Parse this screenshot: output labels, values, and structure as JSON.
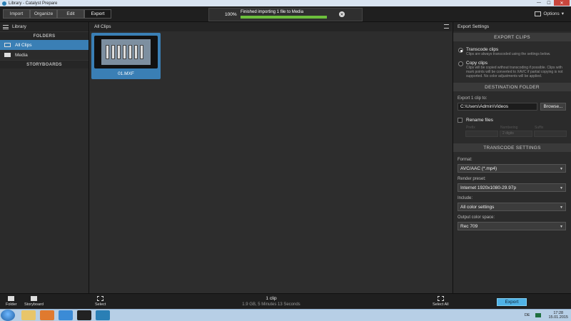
{
  "window": {
    "title": "Library - Catalyst Prepare"
  },
  "tabs": [
    "Import",
    "Organize",
    "Edit",
    "Export"
  ],
  "active_tab": "Export",
  "progress": {
    "percent_text": "100%",
    "message": "Finished importing 1 file to Media",
    "fraction": 1.0
  },
  "options_label": "Options",
  "library": {
    "title": "Library",
    "folders_header": "FOLDERS",
    "items": [
      {
        "label": "All Clips",
        "icon": "clips-icon",
        "selected": true
      },
      {
        "label": "Media",
        "icon": "folder-icon",
        "selected": false
      }
    ],
    "storyboards_header": "STORYBOARDS"
  },
  "main": {
    "title": "All Clips",
    "clips": [
      {
        "name": "01.MXF"
      }
    ]
  },
  "export_settings": {
    "title": "Export Settings",
    "export_clips_header": "EXPORT CLIPS",
    "transcode": {
      "label": "Transcode clips",
      "desc": "Clips are always transcoded using the settings below.",
      "selected": true
    },
    "copy": {
      "label": "Copy clips",
      "desc": "Clips will be copied without transcoding if possible. Clips with mark points will be converted to XAVC if partial copying is not supported. No color adjustments will be applied.",
      "selected": false
    },
    "destination_header": "DESTINATION FOLDER",
    "export_to_label": "Export 1 clip to:",
    "path": "C:\\Users\\Admin\\Videos",
    "browse_label": "Browse...",
    "rename_label": "Rename files",
    "rename_prefix": "Prefix",
    "rename_numbering": "Numbering",
    "rename_suffix": "Suffix",
    "rename_digits": "2 digits",
    "transcode_header": "TRANSCODE SETTINGS",
    "format_label": "Format:",
    "format_value": "AVC/AAC (*.mp4)",
    "preset_label": "Render preset:",
    "preset_value": "Internet 1920x1080-29.97p",
    "include_label": "Include:",
    "include_value": "All color settings",
    "colorspace_label": "Output color space:",
    "colorspace_value": "Rec 709"
  },
  "bottom": {
    "folder_label": "Folder",
    "storyboard_label": "Storyboard",
    "select_label": "Select",
    "status_count": "1 clip",
    "status_detail": "1.9 GB, 5 Minutes 13 Seconds",
    "select_all_label": "Select All",
    "export_button": "Export"
  },
  "taskbar": {
    "lang": "DE",
    "time": "17:28",
    "date": "15.01.2015"
  },
  "colors": {
    "accent": "#3a7fb5",
    "export_button": "#4fb2e6",
    "progress_fill": "#6cbf3c"
  }
}
